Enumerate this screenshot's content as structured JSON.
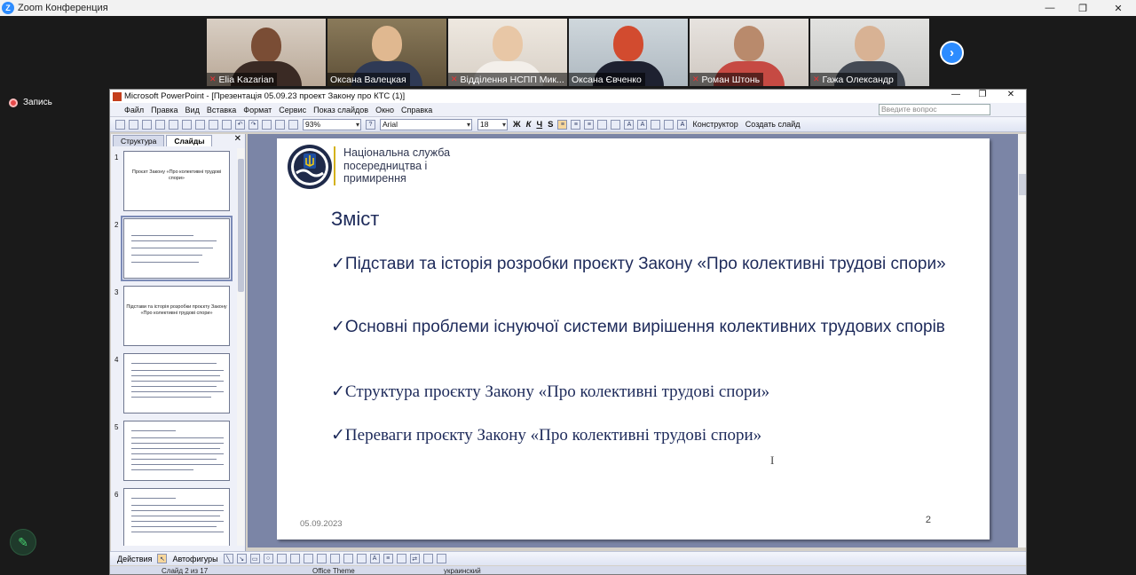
{
  "zoom": {
    "title": "Zoom Конференция",
    "record_label": "Запись",
    "participants": [
      {
        "name": "Elia Kazarian",
        "muted": true
      },
      {
        "name": "Оксана Валецкая",
        "muted": false
      },
      {
        "name": "Відділення НСПП Мик...",
        "muted": true
      },
      {
        "name": "Оксана Євченко",
        "muted": false,
        "active": true
      },
      {
        "name": "Роман Штонь",
        "muted": true
      },
      {
        "name": "Гажа Олександр",
        "muted": true
      }
    ]
  },
  "ppt": {
    "title": "Microsoft PowerPoint - [Презентація 05.09.23 проект Закону про КТС (1)]",
    "menu": [
      "Файл",
      "Правка",
      "Вид",
      "Вставка",
      "Формат",
      "Сервис",
      "Показ слайдов",
      "Окно",
      "Справка"
    ],
    "help_placeholder": "Введите вопрос",
    "zoom_value": "93%",
    "font_value": "Arial",
    "font_size_value": "18",
    "bold": "Ж",
    "italic": "К",
    "underline": "Ч",
    "shadow": "S",
    "designer_label": "Конструктор",
    "new_slide_label": "Создать слайд",
    "tabs": [
      "Структура",
      "Слайды"
    ],
    "thumb_numbers": [
      "1",
      "2",
      "3",
      "4",
      "5",
      "6"
    ],
    "thumb1_title": "Проєкт Закону «Про колективні трудові спори»",
    "thumb3_title": "Підстави та історія розробки проєкту Закону «Про колективні трудові спори»",
    "drawbar": {
      "actions": "Действия",
      "autoshapes": "Автофигуры"
    },
    "status": {
      "slide": "Слайд 2 из 17",
      "theme": "Office Theme",
      "lang": "украинский"
    }
  },
  "slide": {
    "org_name": "Національна служба посередництва і примирення",
    "title": "Зміст",
    "bullets": [
      "✓Підстави та історія розробки проєкту Закону «Про колективні трудові спори»",
      "✓Основні проблеми існуючої системи  вирішення колективних трудових спорів",
      "✓Структура проєкту Закону «Про колективні трудові спори»",
      "✓Переваги проєкту Закону «Про колективні трудові спори»"
    ],
    "date": "05.09.2023",
    "number": "2"
  },
  "colors": {
    "zoom_blue": "#2d8cff",
    "slide_text": "#1d2a5a",
    "slide_bg_area": "#7b85a6"
  }
}
